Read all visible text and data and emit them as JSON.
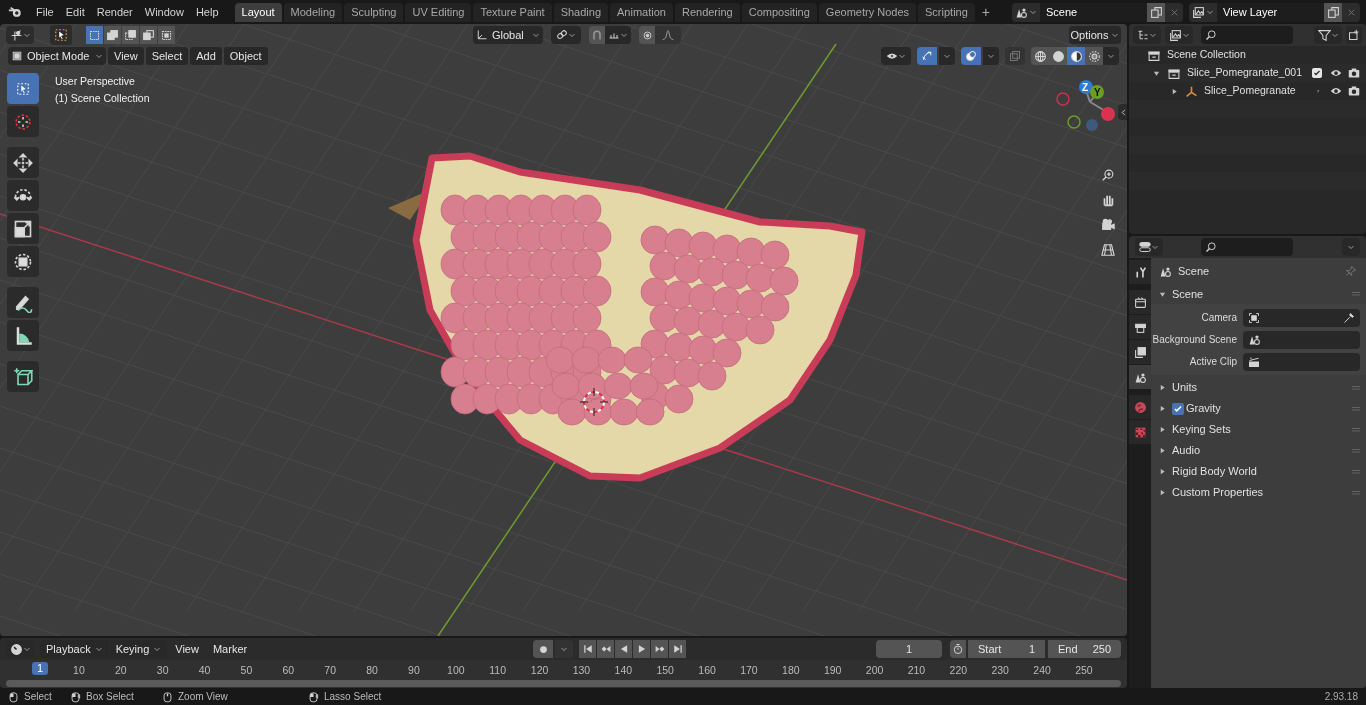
{
  "menu": [
    "File",
    "Edit",
    "Render",
    "Window",
    "Help"
  ],
  "workspaces": [
    {
      "label": "Layout",
      "selected": true
    },
    {
      "label": "Modeling",
      "selected": false
    },
    {
      "label": "Sculpting",
      "selected": false
    },
    {
      "label": "UV Editing",
      "selected": false
    },
    {
      "label": "Texture Paint",
      "selected": false
    },
    {
      "label": "Shading",
      "selected": false
    },
    {
      "label": "Animation",
      "selected": false
    },
    {
      "label": "Rendering",
      "selected": false
    },
    {
      "label": "Compositing",
      "selected": false
    },
    {
      "label": "Geometry Nodes",
      "selected": false
    },
    {
      "label": "Scripting",
      "selected": false
    }
  ],
  "add_workspace": "+",
  "scene": "Scene",
  "view_layer": "View Layer",
  "viewport": {
    "select_modes": [
      {
        "kind": "new",
        "selected": true
      },
      {
        "kind": "extend",
        "selected": false
      },
      {
        "kind": "subtract",
        "selected": false
      },
      {
        "kind": "invert",
        "selected": false
      },
      {
        "kind": "intersect",
        "selected": false
      }
    ],
    "orientation": "Global",
    "options": "Options",
    "mode": "Object Mode",
    "menus": [
      "View",
      "Select",
      "Add",
      "Object"
    ],
    "shading": [
      {
        "kind": "wireframe",
        "selected": false
      },
      {
        "kind": "solid",
        "selected": false
      },
      {
        "kind": "material",
        "selected": true
      },
      {
        "kind": "rendered",
        "selected": false
      }
    ],
    "overlay_text": [
      "User Perspective",
      "(1) Scene Collection"
    ],
    "gizmo_labels": [
      "Z",
      "Y"
    ],
    "tools": [
      {
        "kind": "select",
        "selected": true
      },
      {
        "kind": "cursor",
        "selected": false
      },
      {
        "kind": "move",
        "selected": false
      },
      {
        "kind": "rotate",
        "selected": false
      },
      {
        "kind": "scale",
        "selected": false
      },
      {
        "kind": "transform",
        "selected": false
      },
      {
        "kind": "annotate",
        "selected": false
      },
      {
        "kind": "measure",
        "selected": false
      },
      {
        "kind": "add-cube",
        "selected": false
      }
    ]
  },
  "outliner": {
    "root": "Scene Collection",
    "items": [
      {
        "label": "Slice_Pomegranate_001",
        "expanded": true,
        "checked": true,
        "children": [
          {
            "label": "Slice_Pomegranate",
            "expanded": false
          }
        ]
      }
    ]
  },
  "properties": {
    "tabs": [
      {
        "kind": "tool",
        "selected": false
      },
      {
        "kind": "render",
        "selected": false
      },
      {
        "kind": "output",
        "selected": false
      },
      {
        "kind": "view-layer",
        "selected": false
      },
      {
        "kind": "scene",
        "selected": true
      },
      {
        "kind": "world",
        "selected": false
      },
      {
        "kind": "texture",
        "selected": false
      }
    ],
    "context": "Scene",
    "panel": {
      "label": "Scene",
      "expanded": true,
      "fields": [
        {
          "label": "Camera",
          "kind": "camera"
        },
        {
          "label": "Background Scene",
          "kind": "scene"
        },
        {
          "label": "Active Clip",
          "kind": "clip"
        }
      ]
    },
    "subpanels": [
      {
        "label": "Units",
        "expanded": false
      },
      {
        "label": "Gravity",
        "expanded": false,
        "checked": true
      },
      {
        "label": "Keying Sets",
        "expanded": false
      },
      {
        "label": "Audio",
        "expanded": false
      },
      {
        "label": "Rigid Body World",
        "expanded": false
      },
      {
        "label": "Custom Properties",
        "expanded": false
      }
    ]
  },
  "timeline": {
    "dropdowns": [
      "Playback",
      "Keying"
    ],
    "menus": [
      "View",
      "Marker"
    ],
    "current_frame": "1",
    "start_label": "Start",
    "start": "1",
    "end_label": "End",
    "end": "250",
    "playhead": "1",
    "ticks": [
      "10",
      "20",
      "30",
      "40",
      "50",
      "60",
      "70",
      "80",
      "90",
      "100",
      "110",
      "120",
      "130",
      "140",
      "150",
      "160",
      "170",
      "180",
      "190",
      "200",
      "210",
      "220",
      "230",
      "240",
      "250"
    ]
  },
  "status_bar": {
    "hints": [
      {
        "label": "Select",
        "kind": "left"
      },
      {
        "label": "Box Select",
        "kind": "drag"
      },
      {
        "label": "Zoom View",
        "kind": "middle"
      },
      {
        "label": "Lasso Select",
        "kind": "drag"
      }
    ],
    "version": "2.93.18"
  }
}
